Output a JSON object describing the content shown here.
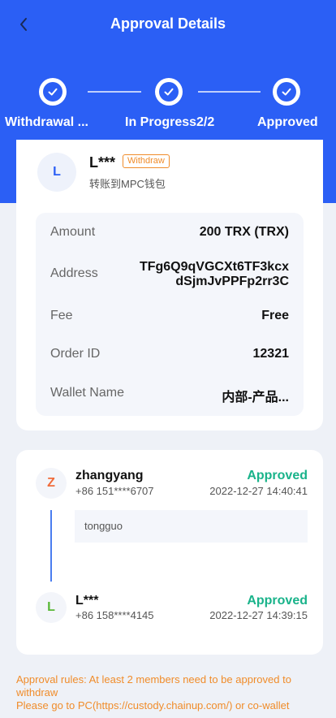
{
  "header": {
    "title": "Approval Details",
    "back_icon": "chevron-left-icon"
  },
  "steps": [
    {
      "label": "Withdrawal ...",
      "icon": "check-icon",
      "done": true
    },
    {
      "label": "In Progress2/2",
      "icon": "check-icon",
      "done": true
    },
    {
      "label": "Approved",
      "icon": "check-icon",
      "done": true
    }
  ],
  "request": {
    "avatar_letter": "L",
    "name": "L***",
    "badge": "Withdraw",
    "subtitle": "转账到MPC钱包",
    "details": [
      {
        "label": "Amount",
        "value": "200 TRX (TRX)"
      },
      {
        "label": "Address",
        "value_line1": "TFg6Q9qVGCXt6TF3kcx",
        "value_line2": "dSjmJvPPFp2rr3C"
      },
      {
        "label": "Fee",
        "value": "Free"
      },
      {
        "label": "Order ID",
        "value": "12321"
      },
      {
        "label": "Wallet Name",
        "value": "内部-产品..."
      }
    ]
  },
  "approvals": [
    {
      "avatar_letter": "Z",
      "name": "zhangyang",
      "phone": "+86 151****6707",
      "status": "Approved",
      "time": "2022-12-27 14:40:41",
      "comment": "tongguo"
    },
    {
      "avatar_letter": "L",
      "name": "L***",
      "phone": "+86 158****4145",
      "status": "Approved",
      "time": "2022-12-27 14:39:15"
    }
  ],
  "rules": {
    "line1": "Approval rules: At least 2 members need to be approved to withdraw",
    "line2": "Please go to PC(https://custody.chainup.com/) or co-wallet"
  },
  "colors": {
    "brand_blue": "#2b5ff5",
    "approved_green": "#19b38a",
    "warning_orange": "#f08c2a"
  }
}
